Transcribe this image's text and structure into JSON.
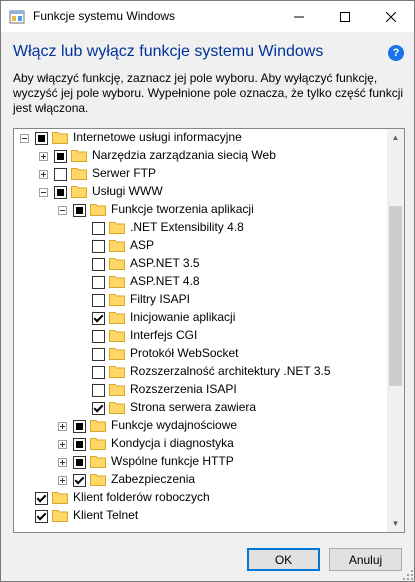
{
  "window": {
    "title": "Funkcje systemu Windows",
    "header": "Włącz lub wyłącz funkcje systemu Windows",
    "description": "Aby włączyć funkcję, zaznacz jej pole wyboru. Aby wyłączyć funkcję, wyczyść jej pole wyboru. Wypełnione pole oznacza, że tylko część funkcji jest włączona."
  },
  "tree": [
    {
      "level": 0,
      "expander": "minus",
      "state": "partial",
      "label": "Internetowe usługi informacyjne"
    },
    {
      "level": 1,
      "expander": "plus",
      "state": "partial",
      "label": "Narzędzia zarządzania siecią Web"
    },
    {
      "level": 1,
      "expander": "plus",
      "state": "unchecked",
      "label": "Serwer FTP"
    },
    {
      "level": 1,
      "expander": "minus",
      "state": "partial",
      "label": "Usługi WWW"
    },
    {
      "level": 2,
      "expander": "minus",
      "state": "partial",
      "label": "Funkcje tworzenia aplikacji"
    },
    {
      "level": 3,
      "expander": "none",
      "state": "unchecked",
      "label": ".NET Extensibility 4.8"
    },
    {
      "level": 3,
      "expander": "none",
      "state": "unchecked",
      "label": "ASP"
    },
    {
      "level": 3,
      "expander": "none",
      "state": "unchecked",
      "label": "ASP.NET 3.5"
    },
    {
      "level": 3,
      "expander": "none",
      "state": "unchecked",
      "label": "ASP.NET 4.8"
    },
    {
      "level": 3,
      "expander": "none",
      "state": "unchecked",
      "label": "Filtry ISAPI"
    },
    {
      "level": 3,
      "expander": "none",
      "state": "checked",
      "label": "Inicjowanie aplikacji"
    },
    {
      "level": 3,
      "expander": "none",
      "state": "unchecked",
      "label": "Interfejs CGI"
    },
    {
      "level": 3,
      "expander": "none",
      "state": "unchecked",
      "label": "Protokół WebSocket"
    },
    {
      "level": 3,
      "expander": "none",
      "state": "unchecked",
      "label": "Rozszerzalność architektury .NET 3.5"
    },
    {
      "level": 3,
      "expander": "none",
      "state": "unchecked",
      "label": "Rozszerzenia ISAPI"
    },
    {
      "level": 3,
      "expander": "none",
      "state": "checked",
      "label": "Strona serwera zawiera"
    },
    {
      "level": 2,
      "expander": "plus",
      "state": "partial",
      "label": "Funkcje wydajnościowe"
    },
    {
      "level": 2,
      "expander": "plus",
      "state": "partial",
      "label": "Kondycja i diagnostyka"
    },
    {
      "level": 2,
      "expander": "plus",
      "state": "partial",
      "label": "Wspólne funkcje HTTP"
    },
    {
      "level": 2,
      "expander": "plus",
      "state": "checked",
      "label": "Zabezpieczenia"
    },
    {
      "level": 0,
      "expander": "none",
      "state": "checked",
      "label": "Klient folderów roboczych"
    },
    {
      "level": 0,
      "expander": "none",
      "state": "checked",
      "label": "Klient Telnet"
    }
  ],
  "buttons": {
    "ok": "OK",
    "cancel": "Anuluj"
  },
  "icons": {
    "app": "app-window-icon",
    "folder": "folder-icon",
    "help": "help-icon"
  },
  "colors": {
    "header": "#003399",
    "help": "#1a73e8",
    "folder": "#ffd766"
  },
  "scrollbar": {
    "position": 0.25
  }
}
